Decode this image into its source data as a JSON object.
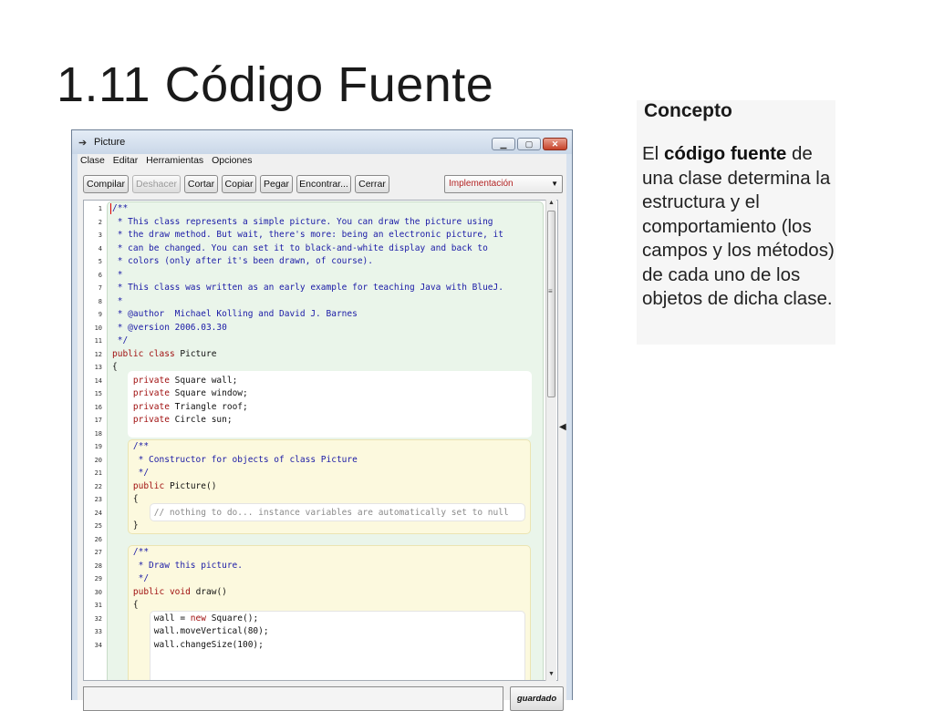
{
  "slide": {
    "title": "1.11 Código Fuente"
  },
  "window": {
    "title": "Picture",
    "menu": [
      "Clase",
      "Editar",
      "Herramientas",
      "Opciones"
    ],
    "toolbar": {
      "compile": "Compilar",
      "undo": "Deshacer",
      "cut": "Cortar",
      "copy": "Copiar",
      "paste": "Pegar",
      "find": "Encontrar...",
      "close": "Cerrar"
    },
    "view_select": "Implementación",
    "status": {
      "saved_label": "guardado",
      "message": ""
    }
  },
  "editor": {
    "lines": [
      {
        "n": "1",
        "text": "/**"
      },
      {
        "n": "2",
        "text": " * This class represents a simple picture. You can draw the picture using"
      },
      {
        "n": "3",
        "text": " * the draw method. But wait, there's more: being an electronic picture, it"
      },
      {
        "n": "4",
        "text": " * can be changed. You can set it to black-and-white display and back to"
      },
      {
        "n": "5",
        "text": " * colors (only after it's been drawn, of course)."
      },
      {
        "n": "6",
        "text": " *"
      },
      {
        "n": "7",
        "text": " * This class was written as an early example for teaching Java with BlueJ."
      },
      {
        "n": "8",
        "text": " *"
      },
      {
        "n": "9",
        "text": " * @author  Michael Kolling and David J. Barnes"
      },
      {
        "n": "10",
        "text": " * @version 2006.03.30"
      },
      {
        "n": "11",
        "text": " */"
      },
      {
        "n": "12",
        "text": "public class Picture"
      },
      {
        "n": "13",
        "text": "{"
      },
      {
        "n": "14",
        "text": "    private Square wall;"
      },
      {
        "n": "15",
        "text": "    private Square window;"
      },
      {
        "n": "16",
        "text": "    private Triangle roof;"
      },
      {
        "n": "17",
        "text": "    private Circle sun;"
      },
      {
        "n": "18",
        "text": ""
      },
      {
        "n": "19",
        "text": "    /**"
      },
      {
        "n": "20",
        "text": "     * Constructor for objects of class Picture"
      },
      {
        "n": "21",
        "text": "     */"
      },
      {
        "n": "22",
        "text": "    public Picture()"
      },
      {
        "n": "23",
        "text": "    {"
      },
      {
        "n": "24",
        "text": "        // nothing to do... instance variables are automatically set to null"
      },
      {
        "n": "25",
        "text": "    }"
      },
      {
        "n": "26",
        "text": ""
      },
      {
        "n": "27",
        "text": "    /**"
      },
      {
        "n": "28",
        "text": "     * Draw this picture."
      },
      {
        "n": "29",
        "text": "     */"
      },
      {
        "n": "30",
        "text": "    public void draw()"
      },
      {
        "n": "31",
        "text": "    {"
      },
      {
        "n": "32",
        "text": "        wall = new Square();"
      },
      {
        "n": "33",
        "text": "        wall.moveVertical(80);"
      },
      {
        "n": "34",
        "text": "        wall.changeSize(100);"
      }
    ]
  },
  "concept": {
    "title": "Concepto",
    "text_parts": [
      {
        "t": "El ",
        "bold": false
      },
      {
        "t": "código fuente",
        "bold": true
      },
      {
        "t": " de una clase determina la estructura y el comportamiento (los campos y los métodos) de cada uno de los objetos de dicha clase.",
        "bold": false
      }
    ]
  }
}
